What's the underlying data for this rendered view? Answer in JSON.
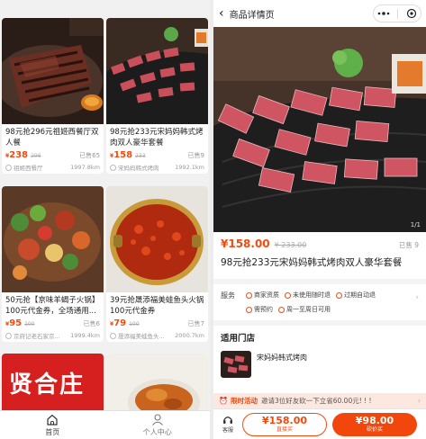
{
  "feed": {
    "cards": [
      {
        "title": "98元抢296元祖姬西餐厅双人餐",
        "currency": "¥",
        "price": "238",
        "original": "296",
        "sold": "已售65",
        "shop": "祖姬西餐厅",
        "distance": "1997.8km"
      },
      {
        "title": "98元抢233元宋妈妈韩式烤肉双人豪华套餐",
        "currency": "¥",
        "price": "158",
        "original": "233",
        "sold": "已售9",
        "shop": "宋妈妈韩式烤肉",
        "distance": "1992.1km"
      },
      {
        "title": "50元抢【京味羊蝎子火锅】100元代金券，全场通用...",
        "currency": "¥",
        "price": "95",
        "original": "100",
        "sold": "已售6",
        "shop": "京府记老石家京...",
        "distance": "1999.4km"
      },
      {
        "title": "39元抢晟添福美蛙鱼头火锅100元代金券",
        "currency": "¥",
        "price": "79",
        "original": "100",
        "sold": "已售7",
        "shop": "晟添福美蛙鱼头...",
        "distance": "2000.7km"
      }
    ],
    "banner_text": "贤合庄"
  },
  "tabbar": {
    "home": "首页",
    "profile": "个人中心"
  },
  "detail": {
    "nav_title": "商品详情页",
    "back_glyph": "‹",
    "pager": "1/1",
    "price_current": "¥158.00",
    "price_original": "¥ 233.00",
    "sold": "已售 9",
    "product_name": "98元抢233元宋妈妈韩式烤肉双人豪华套餐",
    "service_label": "服务",
    "services": [
      "商家资质",
      "未使用随时退",
      "过期自动退",
      "需预约",
      "周一至周日可用"
    ],
    "stores_heading": "适用门店",
    "store_name": "宋妈妈韩式烤肉",
    "promo_tag": "限时活动",
    "promo_text": "邀请3位好友砍一下立省60.00元! ! !",
    "kefu": "客服",
    "buy_alone_price": "¥158.00",
    "buy_alone_label": "直接买",
    "bargain_price": "¥98.00",
    "bargain_label": "砍价买"
  },
  "colors": {
    "accent": "#f24b0f",
    "promo_bg": "#fde8e0"
  }
}
